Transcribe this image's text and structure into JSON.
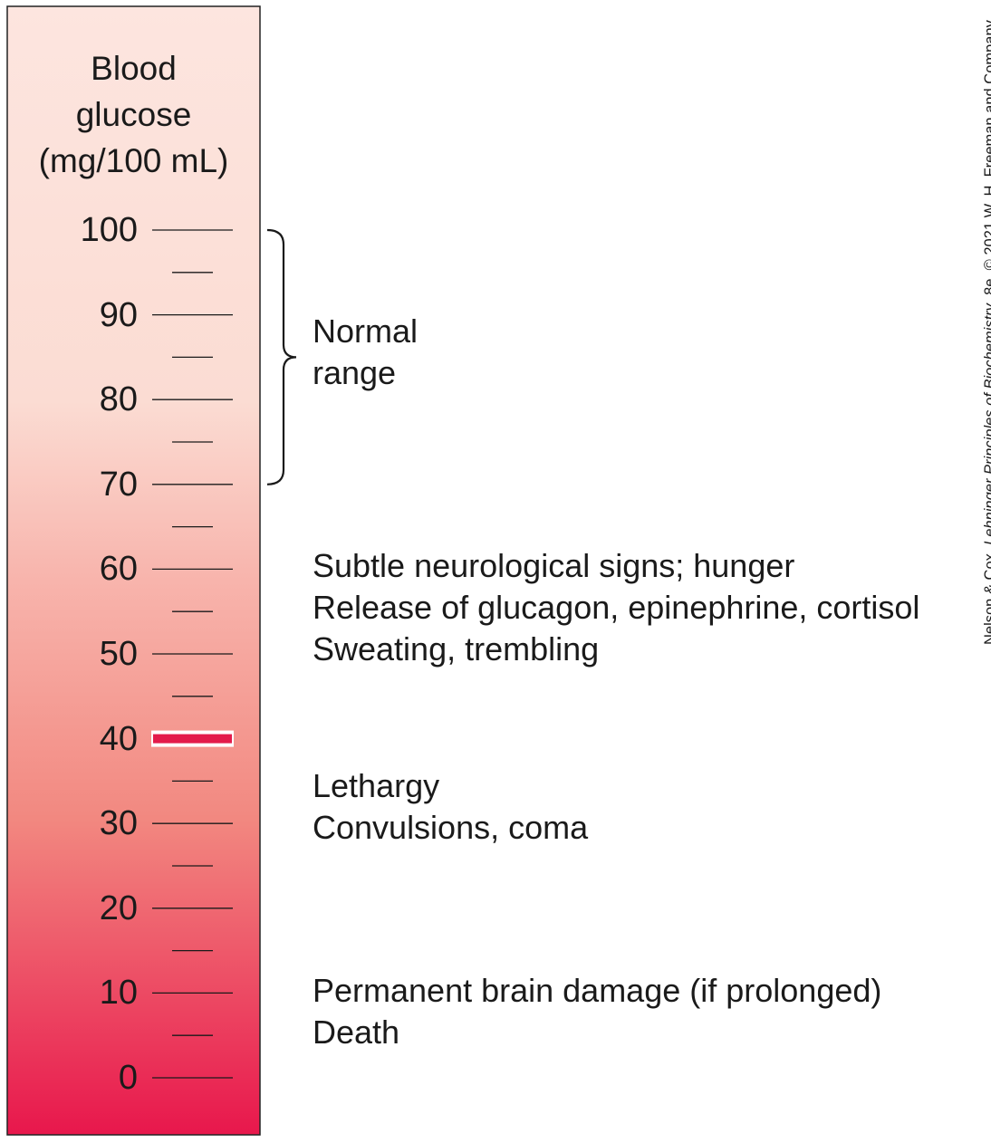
{
  "axis": {
    "title_lines": [
      "Blood",
      "glucose",
      "(mg/100 mL)"
    ],
    "min": 0,
    "max": 100,
    "major_ticks": [
      "100",
      "90",
      "80",
      "70",
      "60",
      "50",
      "40",
      "30",
      "20",
      "10",
      "0"
    ],
    "major_values": [
      100,
      90,
      80,
      70,
      60,
      50,
      40,
      30,
      20,
      10,
      0
    ],
    "minor_values": [
      95,
      85,
      75,
      65,
      55,
      45,
      35,
      25,
      15,
      5
    ],
    "highlight_value": 40
  },
  "normal_range": {
    "low": 70,
    "high": 100,
    "lines": [
      "Normal",
      "range"
    ]
  },
  "effects": {
    "at_60": [
      "Subtle neurological signs; hunger",
      "Release of glucagon, epinephrine, cortisol",
      "Sweating, trembling"
    ],
    "at_35": [
      "Lethargy",
      "Convulsions, coma"
    ],
    "at_10": [
      "Permanent brain damage (if prolonged)",
      "Death"
    ]
  },
  "colors": {
    "gradient_top": "#fde5df",
    "gradient_mid": "#f6a6a2",
    "gradient_bottom": "#e8174c",
    "highlight": "#e31b4b"
  },
  "credit": {
    "prefix": "Nelson & Cox, ",
    "book": "Lehninger Principles of Biochemistry",
    "suffix": ", 8e, © 2021 W. H. Freeman and Company"
  }
}
